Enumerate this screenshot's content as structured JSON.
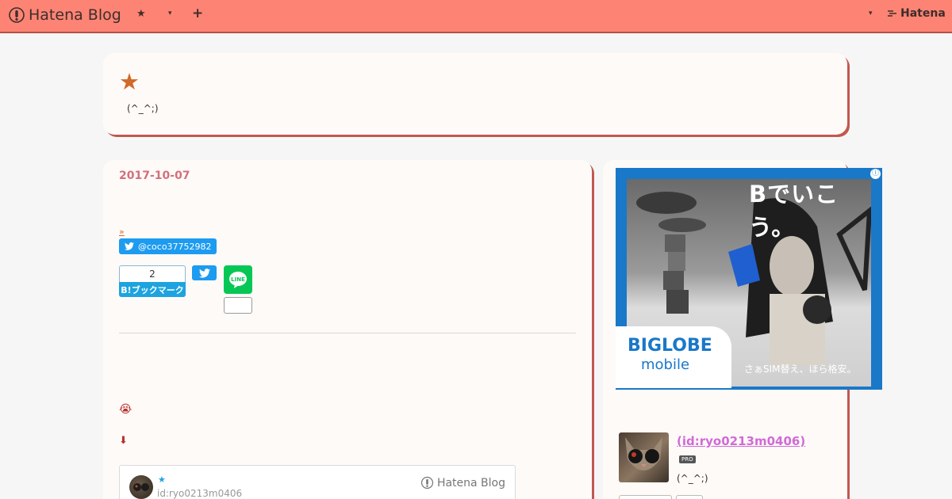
{
  "global_bar": {
    "logo_text": "Hatena Blog",
    "star": "★",
    "dropdown_caret": "▾",
    "plus": "+",
    "right_caret": "▾",
    "hatena_text": "Hatena",
    "bg_color": "#fd8474"
  },
  "header": {
    "star": "★",
    "description": "(^_^;)"
  },
  "entry": {
    "date": "2017-10-07",
    "more_link": "»",
    "follow_handle": "@coco37752982",
    "bookmark_count": "2",
    "bookmark_label": "B!ブックマーク",
    "emoji": "😭",
    "arrow": "⬇",
    "embed": {
      "star": "★",
      "user_id": "id:ryo0213m0406",
      "brand": "Hatena Blog"
    }
  },
  "ad": {
    "headline": "Bでいこう。",
    "brand": "BIGLOBE",
    "sub": "mobile",
    "tagline": "さぁSIM替え、ほら格安。",
    "info": "ⓘ"
  },
  "profile": {
    "name": " (id:ryo0213m0406)",
    "badge": "PRO",
    "description": "(^_^;)"
  },
  "colors": {
    "accent": "#fd8474",
    "shadow": "#c2584f",
    "date": "#d2707d",
    "twitter": "#1d9bf0",
    "line": "#06c755"
  }
}
